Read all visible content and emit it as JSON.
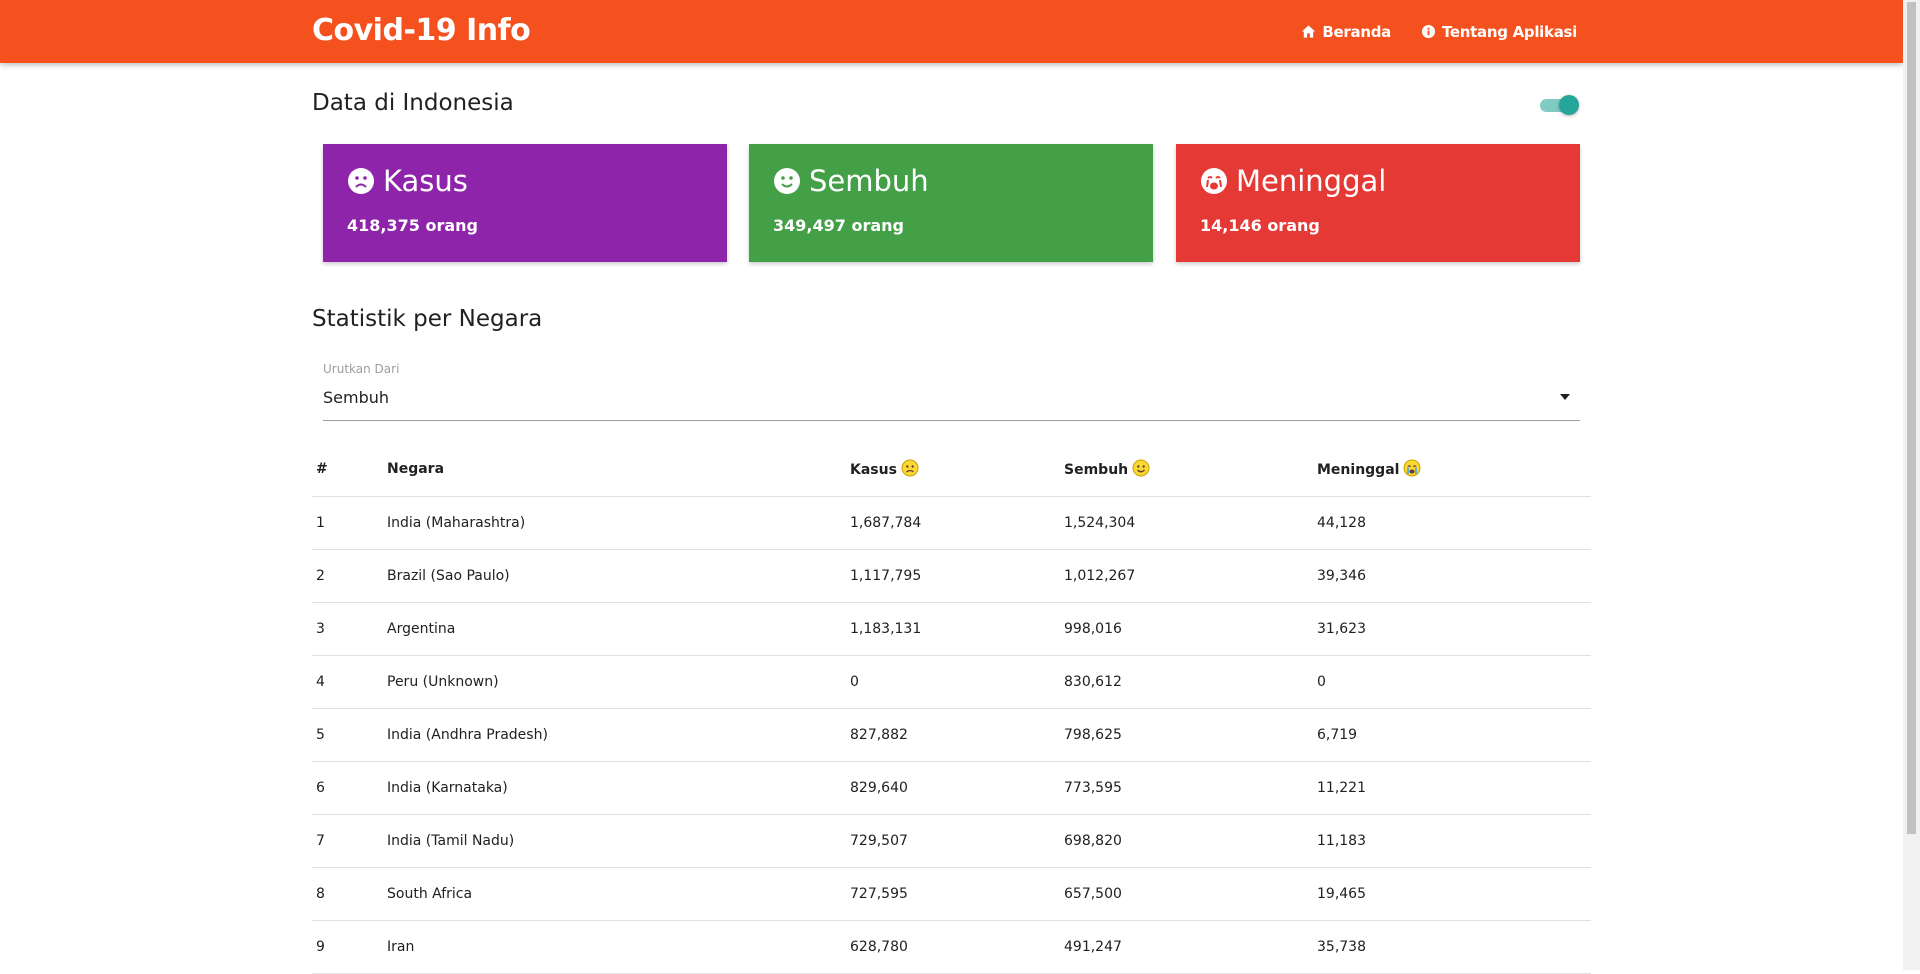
{
  "navbar": {
    "brand": "Covid-19 Info",
    "links": [
      {
        "label": "Beranda",
        "icon": "home-icon"
      },
      {
        "label": "Tentang Aplikasi",
        "icon": "info-circle-icon"
      }
    ],
    "color": "#f4511e"
  },
  "indonesia": {
    "title": "Data di Indonesia",
    "toggle_on": true,
    "cards": [
      {
        "title": "Kasus",
        "count": "418,375 orang",
        "icon": "sad-face-icon",
        "color": "#8e24aa"
      },
      {
        "title": "Sembuh",
        "count": "349,497 orang",
        "icon": "smile-face-icon",
        "color": "#43a047"
      },
      {
        "title": "Meninggal",
        "count": "14,146 orang",
        "icon": "crying-face-icon",
        "color": "#e53935"
      }
    ]
  },
  "stats": {
    "title": "Statistik per Negara",
    "sort": {
      "label": "Urutkan Dari",
      "value": "Sembuh"
    },
    "columns": [
      "#",
      "Negara",
      "Kasus",
      "Sembuh",
      "Meninggal"
    ],
    "rows": [
      [
        "1",
        "India (Maharashtra)",
        "1,687,784",
        "1,524,304",
        "44,128"
      ],
      [
        "2",
        "Brazil (Sao Paulo)",
        "1,117,795",
        "1,012,267",
        "39,346"
      ],
      [
        "3",
        "Argentina",
        "1,183,131",
        "998,016",
        "31,623"
      ],
      [
        "4",
        "Peru (Unknown)",
        "0",
        "830,612",
        "0"
      ],
      [
        "5",
        "India (Andhra Pradesh)",
        "827,882",
        "798,625",
        "6,719"
      ],
      [
        "6",
        "India (Karnataka)",
        "829,640",
        "773,595",
        "11,221"
      ],
      [
        "7",
        "India (Tamil Nadu)",
        "729,507",
        "698,820",
        "11,183"
      ],
      [
        "8",
        "South Africa",
        "727,595",
        "657,500",
        "19,465"
      ],
      [
        "9",
        "Iran",
        "628,780",
        "491,247",
        "35,738"
      ]
    ]
  }
}
